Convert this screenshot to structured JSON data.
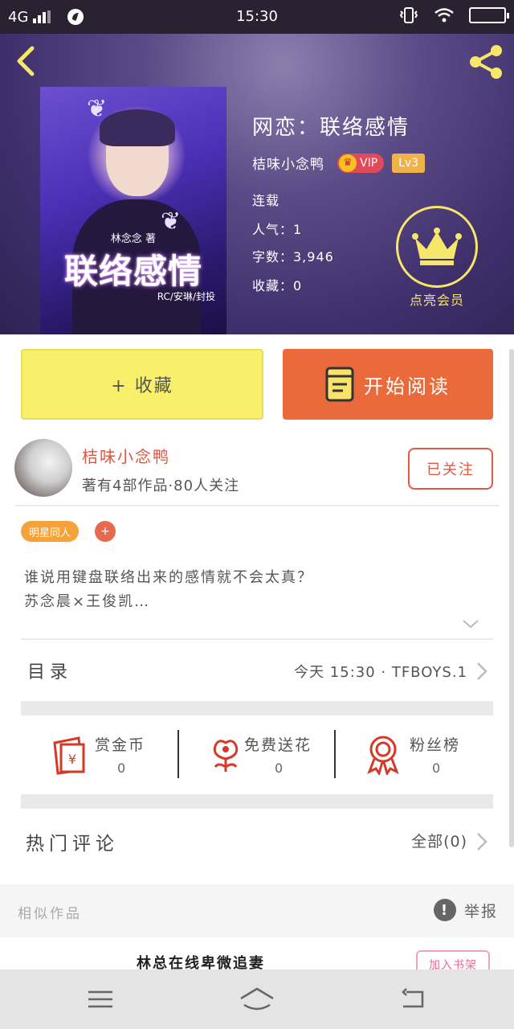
{
  "status_bar": {
    "network": "4G",
    "time": "15:30"
  },
  "book": {
    "title": "网恋：联络感情",
    "author": "桔味小念鸭",
    "vip_label": "VIP",
    "level": "Lv3",
    "status": "连载",
    "popularity": "人气：1",
    "word_count": "字数：3,946",
    "favorites": "收藏：0",
    "cover": {
      "subtitle": "林念念 著",
      "title": "联络感情",
      "credit": "RC/安琳/封投"
    }
  },
  "member_button": {
    "label": "点亮会员"
  },
  "actions": {
    "favorite": "+ 收藏",
    "read": "开始阅读"
  },
  "author_card": {
    "name": "桔味小念鸭",
    "stats": "著有4部作品·80人关注",
    "follow": "已关注"
  },
  "tags": {
    "primary": "明星同人",
    "add": "+"
  },
  "description": [
    "谁说用键盘联络出来的感情就不会太真？",
    "苏念晨×王俊凯…"
  ],
  "catalog": {
    "label": "目录",
    "latest": "今天 15:30 · TFBOYS.1"
  },
  "stats": [
    {
      "label": "赏金币",
      "value": "0",
      "icon": "red-envelope-icon"
    },
    {
      "label": "免费送花",
      "value": "0",
      "icon": "flower-icon"
    },
    {
      "label": "粉丝榜",
      "value": "0",
      "icon": "medal-icon"
    }
  ],
  "comments": {
    "label": "热门评论",
    "all": "全部(0)"
  },
  "similar": {
    "label": "相似作品",
    "report": "举报",
    "first_title": "林总在线卑微追妻",
    "add_shelf": "加入书架"
  },
  "colors": {
    "accent_orange": "#ea6a3c",
    "favorite_yellow": "#f8f06a",
    "author_red": "#e2553d",
    "crown_yellow": "#f6e66a"
  }
}
